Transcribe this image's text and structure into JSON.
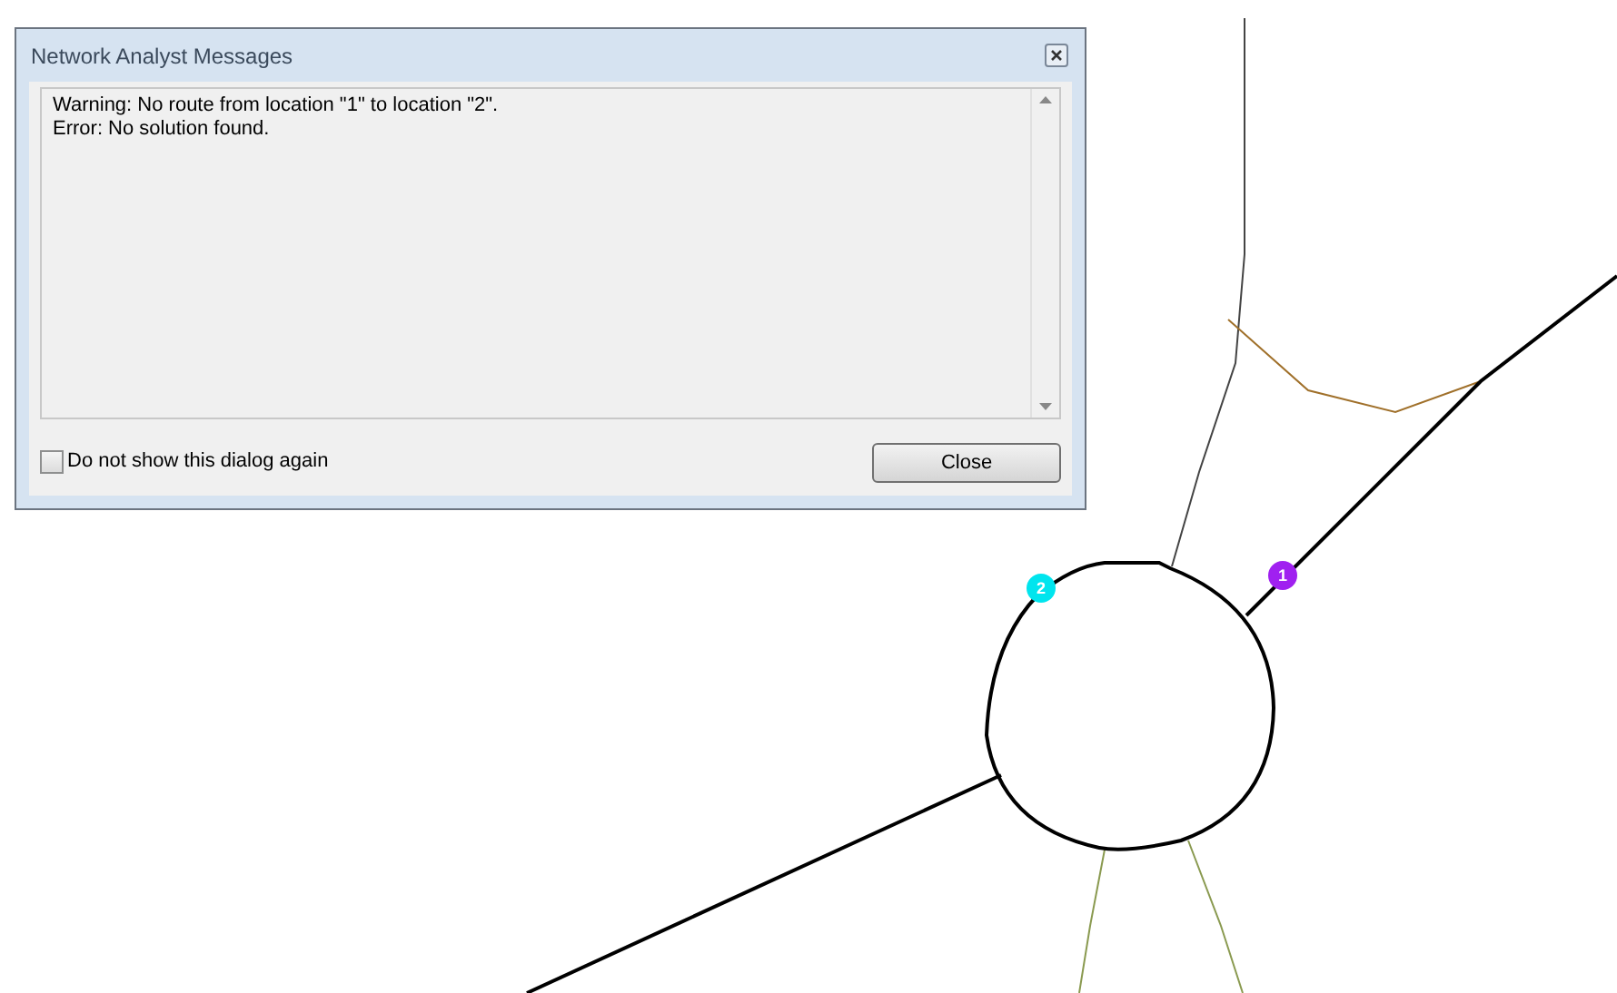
{
  "dialog": {
    "title": "Network Analyst Messages",
    "messages": [
      "Warning: No route from location \"1\" to location \"2\".",
      "Error: No solution found."
    ],
    "checkbox": {
      "label": "Do not show this dialog again",
      "checked": false
    },
    "buttons": [
      "Close"
    ]
  },
  "map": {
    "stops": [
      {
        "label": "1",
        "color": "#a020f0"
      },
      {
        "label": "2",
        "color": "#00e5ee"
      }
    ]
  }
}
